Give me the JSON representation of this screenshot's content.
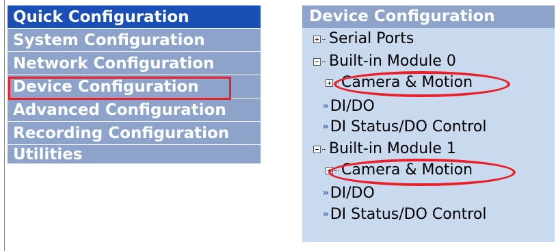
{
  "menu": {
    "items": [
      {
        "label": "Quick Configuration"
      },
      {
        "label": "System Configuration"
      },
      {
        "label": "Network Configuration"
      },
      {
        "label": "Device Configuration"
      },
      {
        "label": "Advanced Configuration"
      },
      {
        "label": "Recording Configuration"
      },
      {
        "label": "Utilities"
      }
    ],
    "active_index": 0,
    "highlighted_item": "Device Configuration"
  },
  "panel": {
    "title": "Device Configuration",
    "tree": [
      {
        "label": "Serial Ports",
        "icon": "expand-plus-icon"
      },
      {
        "label": "Built-in Module 0",
        "icon": "collapse-minus-icon"
      },
      {
        "label": "Camera & Motion",
        "icon": "expand-plus-icon"
      },
      {
        "label": "DI/DO",
        "icon": "double-arrow-icon"
      },
      {
        "label": "DI Status/DO Control",
        "icon": "double-arrow-icon"
      },
      {
        "label": "Built-in Module 1",
        "icon": "collapse-minus-icon"
      },
      {
        "label": "Camera & Motion",
        "icon": "expand-plus-icon"
      },
      {
        "label": "DI/DO",
        "icon": "double-arrow-icon"
      },
      {
        "label": "DI Status/DO Control",
        "icon": "double-arrow-icon"
      }
    ]
  },
  "colors": {
    "menu_bg": "#8da3c9",
    "menu_active_bg": "#1a4fb5",
    "panel_bg": "#c9d9ee",
    "highlight_red": "#e8202a",
    "arrow_blue": "#2a63c5"
  }
}
